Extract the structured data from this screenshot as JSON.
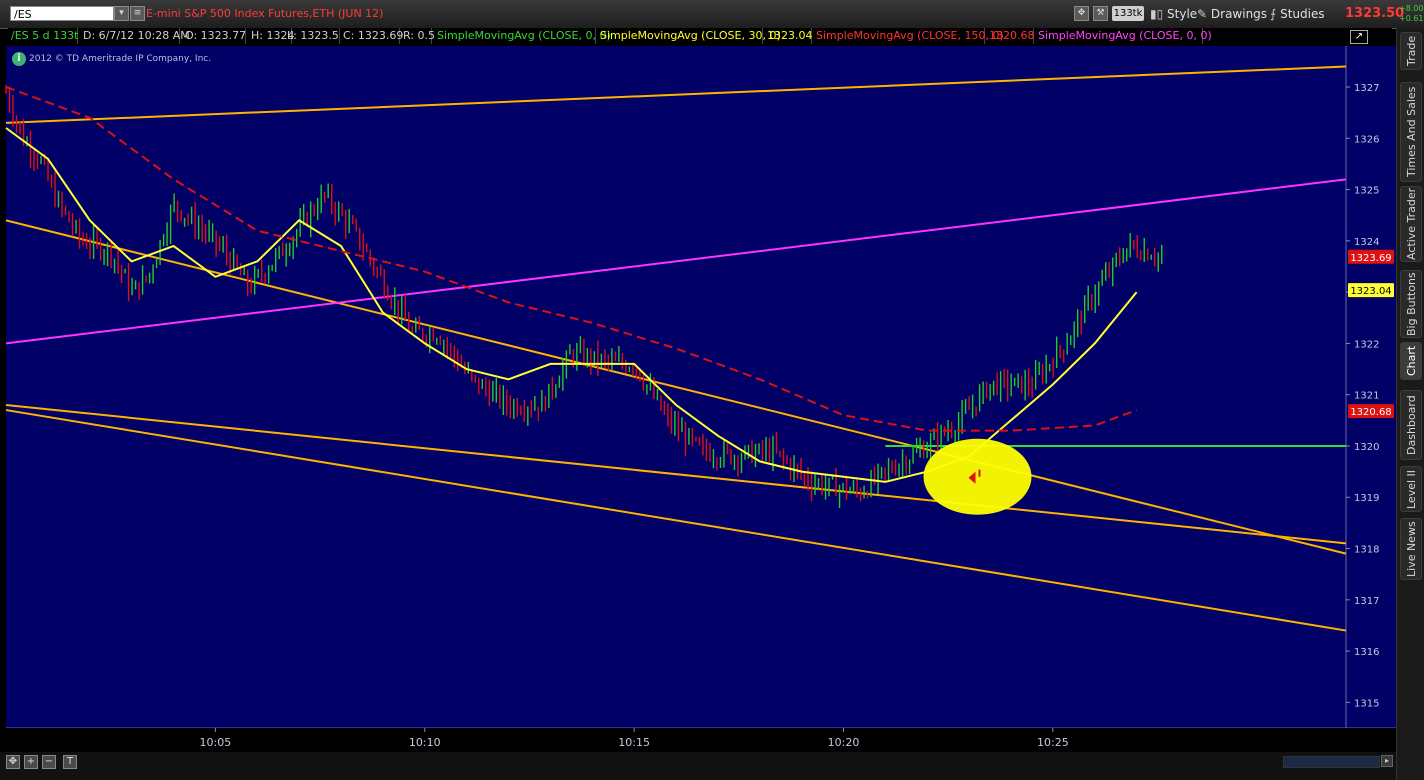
{
  "toolbar": {
    "symbol": "/ES",
    "instrument_title": "E-mini S&P 500 Index Futures,ETH (JUN 12)",
    "tick_button": "133tk",
    "style_label": "Style",
    "drawings_label": "Drawings",
    "studies_label": "Studies",
    "last_price": "1323.50",
    "change_abs": "+8.00",
    "change_pct": "+0.61%"
  },
  "info_bar": {
    "symbol_period": "/ES 5 d 133t",
    "date": "D: 6/7/12 10:28 AM",
    "open": "O: 1323.77",
    "high": "H: 1324",
    "low": "L: 1323.5",
    "close": "C: 1323.69",
    "range": "R: 0.5",
    "study1": "SimpleMovingAvg (CLOSE, 0, 0)",
    "study2": "SimpleMovingAvg (CLOSE, 30, 0)",
    "study2_value": "1323.04",
    "study3": "SimpleMovingAvg (CLOSE, 150, 0)",
    "study3_value": "1320.68",
    "study4": "SimpleMovingAvg (CLOSE, 0, 0)"
  },
  "colors": {
    "background": "#000066",
    "up_bar": "#22cc22",
    "down_bar": "#dd1111",
    "sma30": "#ffff33",
    "sma150": "#dd1111",
    "trendline": "#ffb300",
    "magenta_line": "#ff33ff",
    "support_line": "#33dd33",
    "highlight": "#ffff00"
  },
  "copyright": "2012 © TD Ameritrade IP Company, Inc.",
  "side_tabs": [
    "Trade",
    "Times And Sales",
    "Active Trader",
    "Big Buttons",
    "Chart",
    "Dashboard",
    "Level II",
    "Live News"
  ],
  "active_tab": "Chart",
  "price_labels": {
    "last": "1323.69",
    "sma30": "1323.04",
    "sma150": "1320.68"
  },
  "chart_data": {
    "type": "line",
    "title": "",
    "xlabel": "",
    "ylabel": "",
    "ylim": [
      1314.5,
      1327.8
    ],
    "y_ticks": [
      "1315",
      "1316",
      "1317",
      "1318",
      "1319",
      "1320",
      "1321",
      "1322",
      "1323",
      "1324",
      "1325",
      "1326",
      "1327"
    ],
    "x_ticks": [
      "10:05",
      "10:10",
      "10:15",
      "10:20",
      "10:25"
    ],
    "x_range": [
      "10:00",
      "10:32"
    ],
    "grid": false,
    "price_path": [
      [
        "10:00",
        1326.9
      ],
      [
        "10:00.4",
        1326.0
      ],
      [
        "10:00.8",
        1325.6
      ],
      [
        "10:01.2",
        1324.8
      ],
      [
        "10:01.8",
        1324.0
      ],
      [
        "10:02.5",
        1323.8
      ],
      [
        "10:03.0",
        1323.0
      ],
      [
        "10:03.4",
        1323.3
      ],
      [
        "10:04.0",
        1324.7
      ],
      [
        "10:04.7",
        1324.2
      ],
      [
        "10:05.2",
        1323.8
      ],
      [
        "10:05.8",
        1323.1
      ],
      [
        "10:06.6",
        1323.8
      ],
      [
        "10:07.6",
        1324.9
      ],
      [
        "10:08.3",
        1324.2
      ],
      [
        "10:09.0",
        1323.2
      ],
      [
        "10:09.7",
        1322.2
      ],
      [
        "10:10.3",
        1322.2
      ],
      [
        "10:11.1",
        1321.3
      ],
      [
        "10:12.0",
        1320.8
      ],
      [
        "10:12.8",
        1320.8
      ],
      [
        "10:13.5",
        1321.8
      ],
      [
        "10:14.5",
        1321.6
      ],
      [
        "10:15.0",
        1321.6
      ],
      [
        "10:15.8",
        1320.5
      ],
      [
        "10:16.6",
        1319.9
      ],
      [
        "10:17.4",
        1319.8
      ],
      [
        "10:18.3",
        1319.9
      ],
      [
        "10:19.2",
        1319.3
      ],
      [
        "10:20.4",
        1319.1
      ],
      [
        "10:21.2",
        1319.6
      ],
      [
        "10:22.0",
        1320.0
      ],
      [
        "10:22.8",
        1320.5
      ],
      [
        "10:23.5",
        1321.2
      ],
      [
        "10:24.5",
        1321.2
      ],
      [
        "10:25.3",
        1322.0
      ],
      [
        "10:26.0",
        1323.0
      ],
      [
        "10:26.8",
        1323.9
      ],
      [
        "10:27.2",
        1323.8
      ],
      [
        "10:27.6",
        1323.7
      ]
    ],
    "series": [
      {
        "name": "SimpleMovingAvg (CLOSE, 30, 0)",
        "style": "solid",
        "points": [
          [
            "10:00",
            1326.2
          ],
          [
            "10:01",
            1325.6
          ],
          [
            "10:02",
            1324.4
          ],
          [
            "10:03",
            1323.6
          ],
          [
            "10:04",
            1323.9
          ],
          [
            "10:05",
            1323.3
          ],
          [
            "10:06",
            1323.6
          ],
          [
            "10:07",
            1324.4
          ],
          [
            "10:08",
            1323.9
          ],
          [
            "10:09",
            1322.6
          ],
          [
            "10:10",
            1322.0
          ],
          [
            "10:11",
            1321.5
          ],
          [
            "10:12",
            1321.3
          ],
          [
            "10:13",
            1321.6
          ],
          [
            "10:14",
            1321.6
          ],
          [
            "10:15",
            1321.6
          ],
          [
            "10:16",
            1320.8
          ],
          [
            "10:17",
            1320.2
          ],
          [
            "10:18",
            1319.7
          ],
          [
            "10:19",
            1319.5
          ],
          [
            "10:20",
            1319.4
          ],
          [
            "10:21",
            1319.3
          ],
          [
            "10:22",
            1319.5
          ],
          [
            "10:23",
            1319.8
          ],
          [
            "10:24",
            1320.5
          ],
          [
            "10:25",
            1321.2
          ],
          [
            "10:26",
            1322.0
          ],
          [
            "10:27",
            1323.0
          ]
        ]
      },
      {
        "name": "SimpleMovingAvg (CLOSE, 150, 0)",
        "style": "dashed",
        "points": [
          [
            "10:00",
            1327.0
          ],
          [
            "10:02",
            1326.4
          ],
          [
            "10:04",
            1325.2
          ],
          [
            "10:06",
            1324.2
          ],
          [
            "10:08",
            1323.8
          ],
          [
            "10:10",
            1323.4
          ],
          [
            "10:12",
            1322.8
          ],
          [
            "10:14",
            1322.4
          ],
          [
            "10:16",
            1321.9
          ],
          [
            "10:18",
            1321.3
          ],
          [
            "10:20",
            1320.6
          ],
          [
            "10:22",
            1320.3
          ],
          [
            "10:24",
            1320.3
          ],
          [
            "10:26",
            1320.4
          ],
          [
            "10:27",
            1320.7
          ]
        ]
      }
    ],
    "trendlines": [
      {
        "color": "orange",
        "from": [
          "10:00",
          1326.3
        ],
        "to": [
          "10:32",
          1327.4
        ]
      },
      {
        "color": "orange",
        "from": [
          "10:00",
          1324.4
        ],
        "to": [
          "10:32",
          1317.9
        ]
      },
      {
        "color": "orange",
        "from": [
          "10:00",
          1320.8
        ],
        "to": [
          "10:32",
          1318.1
        ]
      },
      {
        "color": "orange",
        "from": [
          "10:00",
          1320.7
        ],
        "to": [
          "10:32",
          1316.4
        ]
      },
      {
        "color": "magenta",
        "from": [
          "10:00",
          1322.0
        ],
        "to": [
          "10:32",
          1325.2
        ]
      },
      {
        "color": "green",
        "from": [
          "10:21",
          1320.0
        ],
        "to": [
          "10:32",
          1320.0
        ]
      }
    ],
    "annotations": [
      {
        "type": "ellipse",
        "center": [
          "10:23.2",
          1319.4
        ],
        "color": "yellow"
      }
    ]
  }
}
